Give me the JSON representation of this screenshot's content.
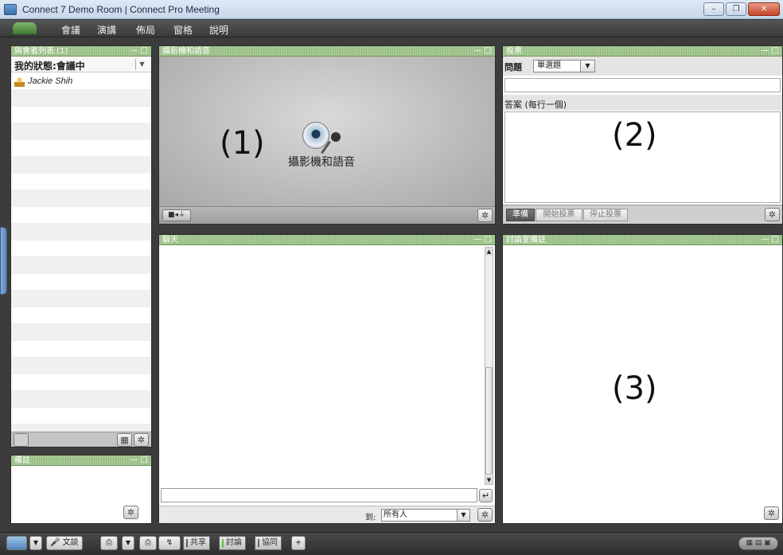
{
  "window": {
    "title": "Connect 7 Demo Room | Connect Pro Meeting",
    "controls": [
      "–",
      "❐",
      "✕"
    ]
  },
  "menubar": {
    "items": [
      "會議",
      "演講",
      "佈局",
      "窗格",
      "說明"
    ]
  },
  "attendees_pod": {
    "title": "與會者列表 (1)",
    "controls": "— □",
    "status_label": "我的狀態:會議中",
    "attendees": [
      "Jackie Shih"
    ]
  },
  "notes_pod": {
    "title": "備註",
    "controls": "— □"
  },
  "camera_pod": {
    "title": "攝影機和語音",
    "controls": "— □",
    "label": "攝影機和語音",
    "marker": "(1)"
  },
  "poll_pod": {
    "title": "投票",
    "controls": "— □",
    "question_label": "問題",
    "question_type": "單選題",
    "answers_label": "答案 (每行一個)",
    "marker": "(2)",
    "buttons": [
      "準備",
      "開始投票",
      "停止投票"
    ]
  },
  "chat_pod": {
    "title": "聊天",
    "controls": "— □",
    "to_label": "到:",
    "to_value": "所有人"
  },
  "discussion_notes_pod": {
    "title": "討論室備註",
    "controls": "— □",
    "marker": "(3)"
  },
  "bottombar": {
    "items": [
      "文談",
      "共享",
      "討論",
      "協同",
      "+"
    ]
  }
}
